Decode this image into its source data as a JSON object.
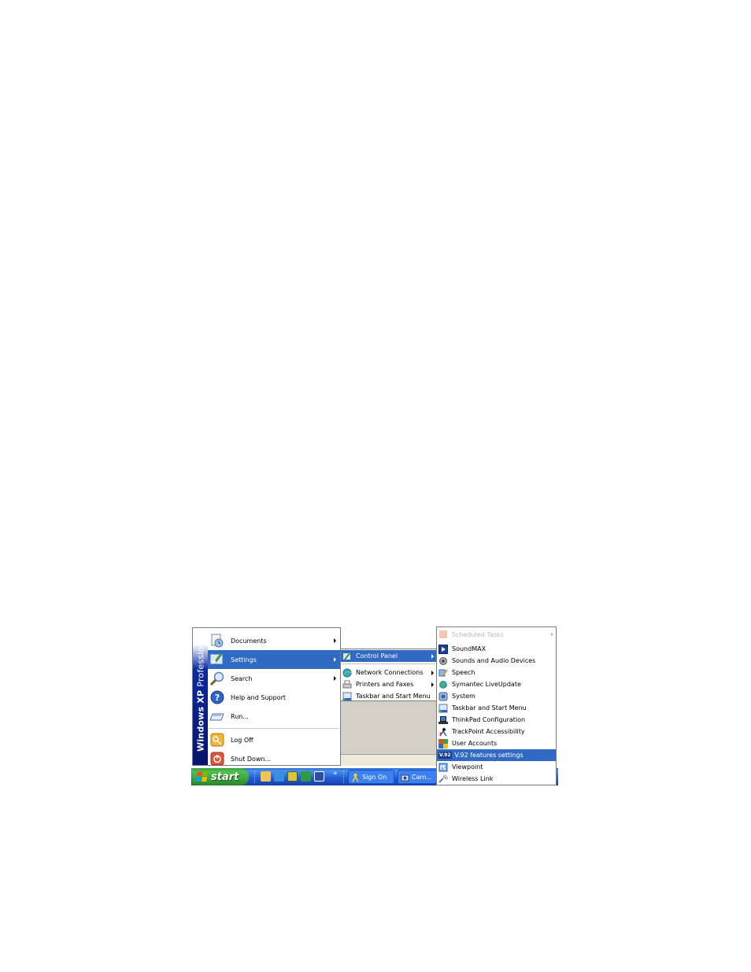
{
  "start_menu": {
    "banner_bold": "Windows XP",
    "banner_light": "Professional",
    "items": [
      {
        "label": "Documents",
        "icon": "documents-icon"
      },
      {
        "label": "Settings",
        "icon": "settings-icon"
      },
      {
        "label": "Search",
        "icon": "search-icon"
      },
      {
        "label": "Help and Support",
        "icon": "help-icon"
      },
      {
        "label": "Run...",
        "icon": "run-icon"
      },
      {
        "label": "Log Off",
        "icon": "logoff-icon"
      },
      {
        "label": "Shut Down...",
        "icon": "shutdown-icon"
      }
    ]
  },
  "settings_menu": {
    "items": [
      {
        "label": "Control Panel"
      },
      {
        "label": "Network Connections"
      },
      {
        "label": "Printers and Faxes"
      },
      {
        "label": "Taskbar and Start Menu"
      }
    ]
  },
  "control_panel_menu": {
    "items": [
      {
        "label": "Scheduled Tasks"
      },
      {
        "label": "SoundMAX"
      },
      {
        "label": "Sounds and Audio Devices"
      },
      {
        "label": "Speech"
      },
      {
        "label": "Symantec LiveUpdate"
      },
      {
        "label": "System"
      },
      {
        "label": "Taskbar and Start Menu"
      },
      {
        "label": "ThinkPad Configuration"
      },
      {
        "label": "TrackPoint Accessibility"
      },
      {
        "label": "User Accounts"
      },
      {
        "label": "V.92 features settings",
        "badge": "V.92"
      },
      {
        "label": "Viewpoint"
      },
      {
        "label": "Wireless Link"
      }
    ]
  },
  "taskbar": {
    "start_label": "start",
    "more": "»",
    "tasks": [
      {
        "label": "Sign On"
      },
      {
        "label": "Cam..."
      }
    ]
  },
  "colors": {
    "selection": "#316ac5",
    "taskbar": "#2157d7",
    "start_button": "#36a236"
  }
}
